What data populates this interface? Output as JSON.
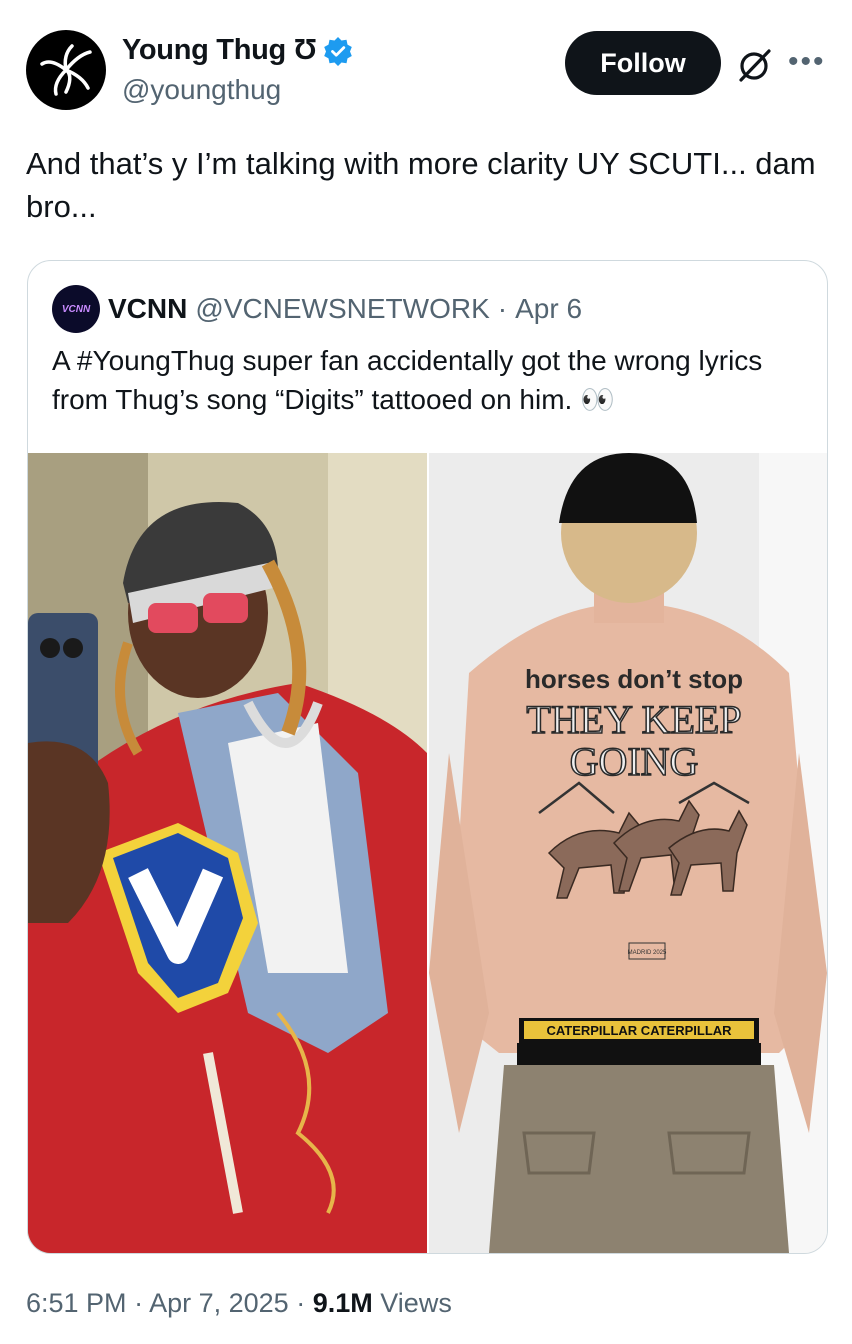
{
  "author": {
    "display_name": "Young Thug Ʊ",
    "handle": "@youngthug",
    "verified": true,
    "avatar_icon": "spider-logo-icon"
  },
  "actions": {
    "follow_label": "Follow",
    "grok_icon": "grok-icon",
    "more_icon": "more-icon"
  },
  "tweet": {
    "text": "And that’s y I’m talking with more clarity UY SCUTI... dam bro..."
  },
  "quote": {
    "avatar_text": "VCNN",
    "name": "VCNN",
    "handle": "@VCNEWSNETWORK",
    "date": "Apr 6",
    "separator": "·",
    "text": "A #YoungThug super fan accidentally got the wrong lyrics from Thug’s song “Digits” tattooed on him. 👀",
    "media": {
      "left_image": "young-thug-selfie",
      "right_image": "fan-back-tattoo",
      "tattoo_line1": "horses don’t stop",
      "tattoo_line2": "THEY KEEP",
      "tattoo_line3": "GOING",
      "waistband": "CATERPILLAR CATERPILLAR",
      "tattoo_small": "MADRID 2025"
    }
  },
  "meta": {
    "time": "6:51 PM",
    "sep1": "·",
    "date": "Apr 7, 2025",
    "sep2": "·",
    "views_count": "9.1M",
    "views_label": "Views"
  },
  "colors": {
    "accent": "#1d9bf0",
    "text": "#0f1419",
    "secondary": "#536471",
    "border": "#cfd9de",
    "jacket_red": "#c8262b"
  }
}
